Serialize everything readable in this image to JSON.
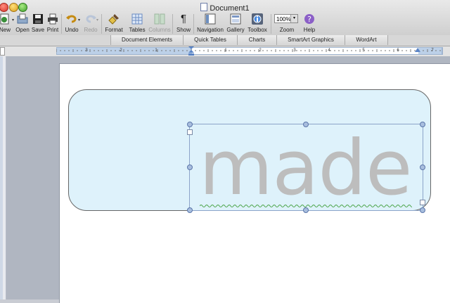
{
  "window": {
    "title": "Document1"
  },
  "toolbar": {
    "new": "New",
    "open": "Open",
    "save": "Save",
    "print": "Print",
    "undo": "Undo",
    "redo": "Redo",
    "format": "Format",
    "tables": "Tables",
    "columns": "Columns",
    "show": "Show",
    "navigation": "Navigation",
    "gallery": "Gallery",
    "toolbox": "Toolbox",
    "zoom_label": "Zoom",
    "zoom_value": "100%",
    "help": "Help"
  },
  "ribbon": {
    "tabs": [
      "Document Elements",
      "Quick Tables",
      "Charts",
      "SmartArt Graphics",
      "WordArt"
    ]
  },
  "ruler": {
    "numbers": [
      "3",
      "2",
      "1",
      "1",
      "2",
      "3",
      "4",
      "5",
      "6",
      "7"
    ]
  },
  "document": {
    "text": "made"
  },
  "colors": {
    "shape_fill": "#def2fb",
    "text_color": "#bdbdbd",
    "selection": "#5b76aa"
  }
}
